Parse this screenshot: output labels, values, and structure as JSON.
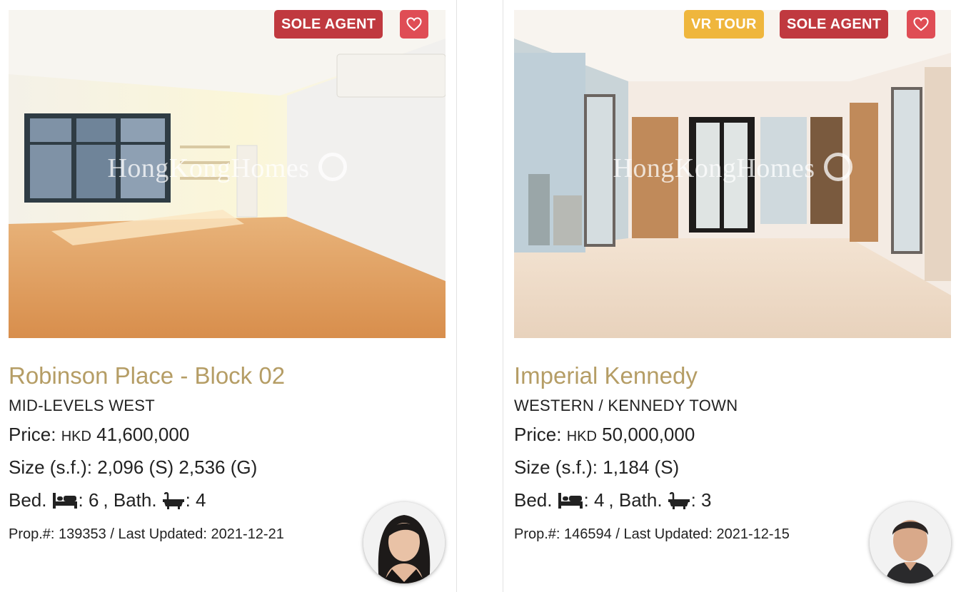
{
  "watermark": "HongKongHomes",
  "colors": {
    "title": "#b59d65",
    "sole_agent_badge": "#c0393f",
    "vr_tour_badge": "#efb63d",
    "favorite_button": "#df4d55"
  },
  "listings": [
    {
      "badges": [
        "SOLE AGENT"
      ],
      "favorite_icon": "heart-outline-icon",
      "title": "Robinson Place - Block 02",
      "district": "MID-LEVELS WEST",
      "price_label": "Price:",
      "currency": "HKD",
      "price": "41,600,000",
      "size_label": "Size (s.f.):",
      "size": "2,096 (S) 2,536 (G)",
      "bed_label": "Bed.",
      "bed_icon": "bed-icon",
      "beds": ": 6",
      "bath_label": ", Bath.",
      "bath_icon": "bathtub-icon",
      "baths": ": 4",
      "meta": "Prop.#: 139353 / Last Updated: 2021-12-21",
      "agent_icon": "agent-avatar"
    },
    {
      "badges": [
        "VR TOUR",
        "SOLE AGENT"
      ],
      "favorite_icon": "heart-outline-icon",
      "title": "Imperial Kennedy",
      "district": "WESTERN / KENNEDY TOWN",
      "price_label": "Price:",
      "currency": "HKD",
      "price": "50,000,000",
      "size_label": "Size (s.f.):",
      "size": "1,184 (S)",
      "bed_label": "Bed.",
      "bed_icon": "bed-icon",
      "beds": ": 4",
      "bath_label": ", Bath.",
      "bath_icon": "bathtub-icon",
      "baths": ": 3",
      "meta": "Prop.#: 146594 / Last Updated: 2021-12-15",
      "agent_icon": "agent-avatar"
    }
  ]
}
